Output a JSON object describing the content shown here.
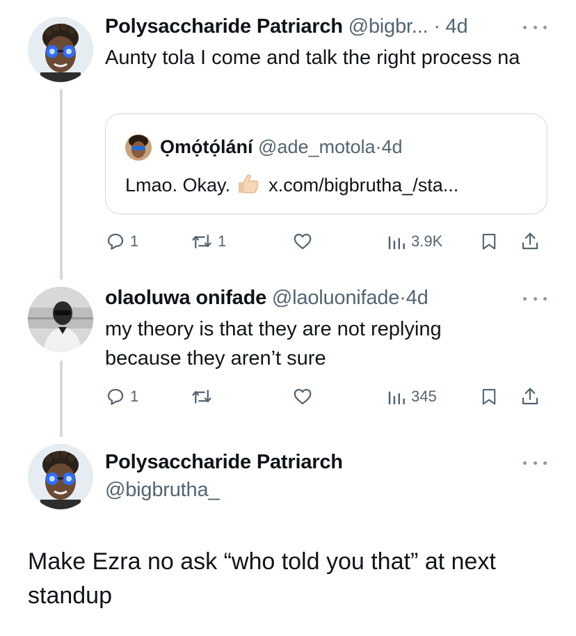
{
  "tweets": [
    {
      "author_name": "Polysaccharide Patriarch",
      "handle": "@bigbr...",
      "separator": "·",
      "time": "4d",
      "text": "Aunty tola I come and talk the right process na",
      "quote": {
        "author_name": "Ọmọ́tọ́lání",
        "handle": "@ade_motola",
        "separator": "·",
        "time": "4d",
        "text": "Lmao. Okay.",
        "link": "x.com/bigbrutha_/sta..."
      },
      "actions": {
        "replies": "1",
        "reposts": "1",
        "likes": "",
        "views": "3.9K"
      }
    },
    {
      "author_name": "olaoluwa onifade",
      "handle": "@laoluonifade",
      "separator": "·",
      "time": "4d",
      "text": "my theory is that they are not replying because they aren’t sure",
      "actions": {
        "replies": "1",
        "reposts": "",
        "likes": "",
        "views": "345"
      }
    },
    {
      "author_name": "Polysaccharide Patriarch",
      "handle": "@bigbrutha_",
      "text": "Make Ezra no ask “who told you that” at next standup"
    }
  ],
  "colors": {
    "text_primary": "#0f1419",
    "text_secondary": "#536471",
    "border": "#cfd9de",
    "thread_line": "#cfd9de"
  },
  "icons": {
    "reply": "reply-icon",
    "repost": "repost-icon",
    "like": "heart-icon",
    "views": "views-icon",
    "bookmark": "bookmark-icon",
    "share": "share-icon",
    "more": "more-icon"
  }
}
